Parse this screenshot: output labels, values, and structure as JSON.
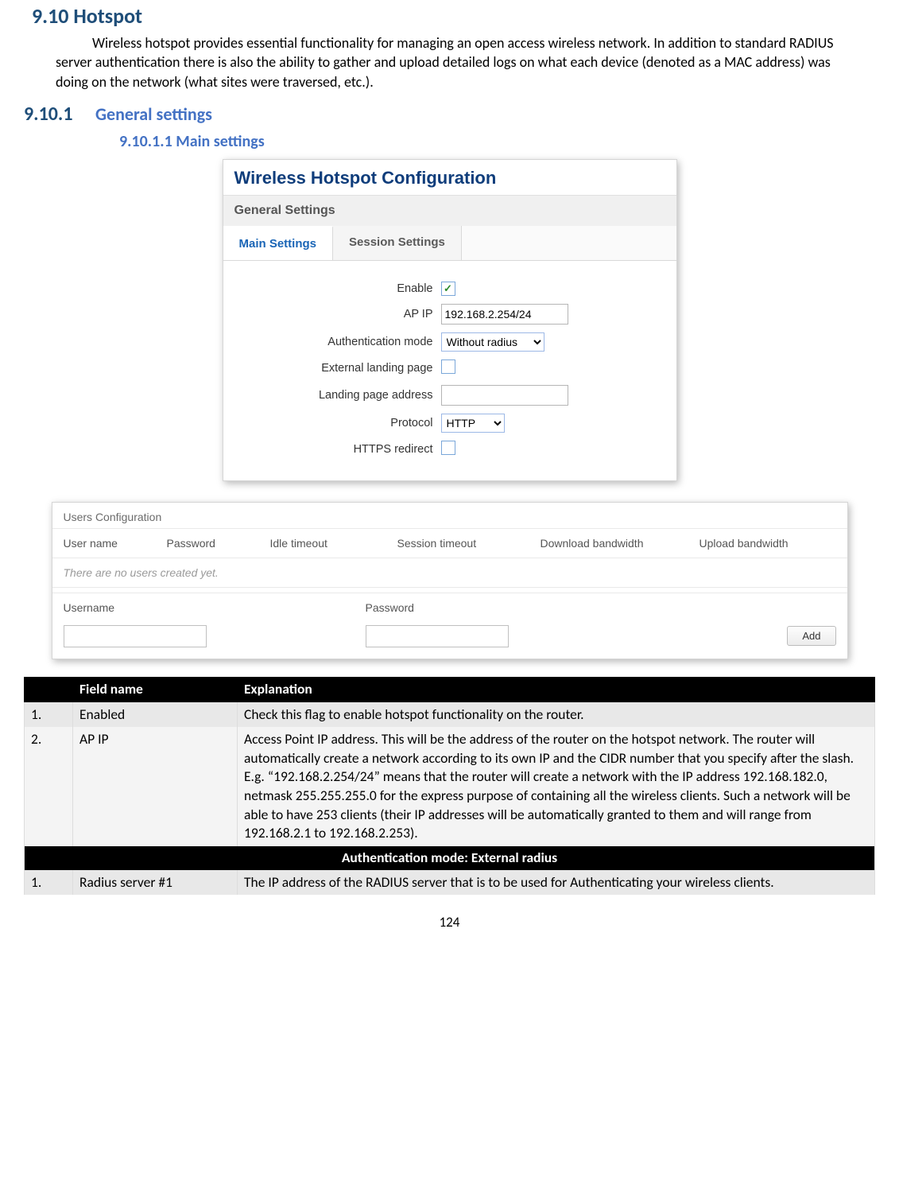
{
  "headings": {
    "h1": "9.10 Hotspot",
    "intro": "Wireless hotspot provides essential functionality for managing an open access wireless network. In addition to standard RADIUS server authentication there is also the ability to gather and upload detailed logs on what each device (denoted as a MAC address) was doing on the network (what sites were traversed, etc.).",
    "h2_num": "9.10.1",
    "h2_txt": "General settings",
    "h3": "9.10.1.1 Main settings"
  },
  "panel1": {
    "title": "Wireless Hotspot Configuration",
    "subtitle": "General Settings",
    "tabs": {
      "t1": "Main Settings",
      "t2": "Session Settings"
    },
    "fields": {
      "enable_label": "Enable",
      "enable_checked": "✓",
      "apip_label": "AP IP",
      "apip_value": "192.168.2.254/24",
      "auth_label": "Authentication mode",
      "auth_value": "Without radius",
      "extland_label": "External landing page",
      "landaddr_label": "Landing page address",
      "landaddr_value": "",
      "proto_label": "Protocol",
      "proto_value": "HTTP",
      "httpsr_label": "HTTPS redirect"
    }
  },
  "panel2": {
    "title": "Users Configuration",
    "cols": {
      "c1": "User name",
      "c2": "Password",
      "c3": "Idle timeout",
      "c4": "Session timeout",
      "c5": "Download bandwidth",
      "c6": "Upload bandwidth"
    },
    "empty": "There are no users created yet.",
    "add_labels": {
      "u": "Username",
      "p": "Password"
    },
    "add_btn": "Add"
  },
  "table": {
    "h_field": "Field name",
    "h_expl": "Explanation",
    "rows1": [
      {
        "n": "1.",
        "f": "Enabled",
        "e": "Check this flag to enable hotspot functionality on the router."
      },
      {
        "n": "2.",
        "f": "AP IP",
        "e": "Access Point IP address. This will be the address of the router on the hotspot network. The router will automatically create a network according to its own IP and the CIDR number that you specify after the slash. E.g. “192.168.2.254/24” means that the router will create a network with the IP address 192.168.182.0, netmask 255.255.255.0 for the express purpose of containing all the wireless clients. Such a network will be able to have 253 clients (their IP addresses will be automatically granted to them and will range from 192.168.2.1 to 192.168.2.253)."
      }
    ],
    "sep": "Authentication mode: External radius",
    "rows2": [
      {
        "n": "1.",
        "f": "Radius server #1",
        "e": "The IP address of the RADIUS server that is to be used for Authenticating your wireless clients."
      }
    ]
  },
  "page_number": "124"
}
